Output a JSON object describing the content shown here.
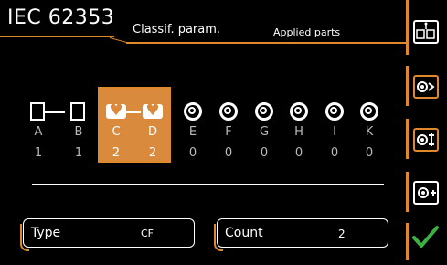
{
  "header": {
    "standard": "IEC 62353",
    "tab_classification": "Classif. param.",
    "tab_applied": "Applied parts"
  },
  "parts": [
    {
      "label": "A",
      "value": "1",
      "icon": "body-part-icon",
      "selected": false
    },
    {
      "label": "B",
      "value": "1",
      "icon": "body-part-icon",
      "selected": false
    },
    {
      "label": "C",
      "value": "2",
      "icon": "heart-part-icon",
      "selected": true
    },
    {
      "label": "D",
      "value": "2",
      "icon": "heart-part-icon",
      "selected": true
    },
    {
      "label": "E",
      "value": "0",
      "icon": "unused-terminal-icon",
      "selected": false
    },
    {
      "label": "F",
      "value": "0",
      "icon": "unused-terminal-icon",
      "selected": false
    },
    {
      "label": "G",
      "value": "0",
      "icon": "unused-terminal-icon",
      "selected": false
    },
    {
      "label": "H",
      "value": "0",
      "icon": "unused-terminal-icon",
      "selected": false
    },
    {
      "label": "I",
      "value": "0",
      "icon": "unused-terminal-icon",
      "selected": false
    },
    {
      "label": "K",
      "value": "0",
      "icon": "unused-terminal-icon",
      "selected": false
    }
  ],
  "fields": {
    "type_label": "Type",
    "type_value": "CF",
    "count_label": "Count",
    "count_value": "2"
  },
  "sidebar": {
    "buttons": [
      "body-heart-type-icon",
      "next-group-icon",
      "swap-group-icon",
      "add-part-icon",
      "confirm-check-icon"
    ]
  },
  "colors": {
    "accent": "#e0882c",
    "selection": "#d98a3c",
    "confirm": "#3cb043"
  }
}
